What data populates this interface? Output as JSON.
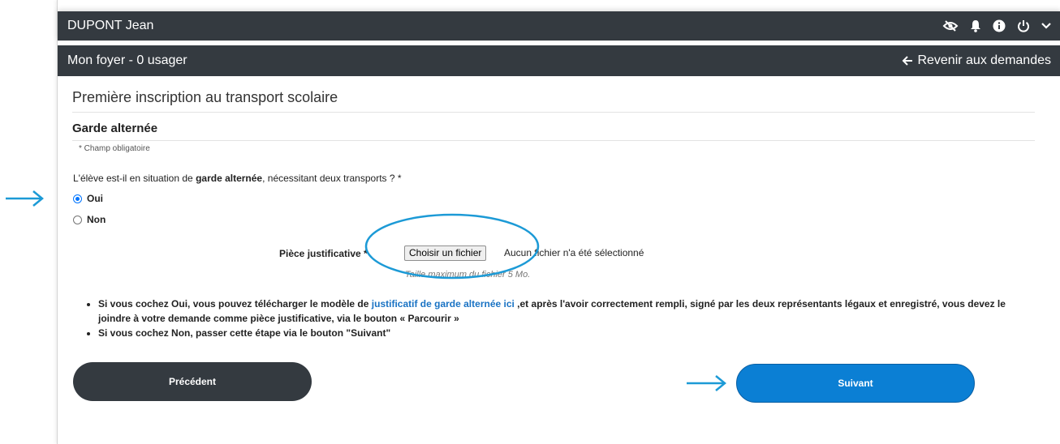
{
  "header": {
    "user_name": "DUPONT Jean",
    "icons": [
      "eye-slash-icon",
      "bell-icon",
      "info-icon",
      "power-icon",
      "chevron-down-icon"
    ]
  },
  "subheader": {
    "foyer": "Mon foyer - 0 usager",
    "back_label": "Revenir aux demandes"
  },
  "page": {
    "title": "Première inscription au transport scolaire",
    "section": "Garde alternée",
    "required_note": "* Champ obligatoire"
  },
  "question": {
    "before": "L'élève est-il en situation de ",
    "bold": "garde alternée",
    "after": ", nécessitant deux transports ? *"
  },
  "options": {
    "oui": "Oui",
    "non": "Non",
    "selected": "Oui"
  },
  "upload": {
    "label": "Pièce justificative *",
    "button": "Choisir un fichier",
    "status": "Aucun fichier n'a été sélectionné",
    "hint": "Taille maximum du fichier 5 Mo."
  },
  "info": {
    "b1_pre": "Si vous cochez Oui, vous pouvez télécharger le modèle de ",
    "b1_link": "justificatif de garde alternée ici",
    "b1_post": " ,et après l'avoir correctement rempli, signé par les deux représentants légaux et enregistré, vous devez le joindre à votre demande comme pièce justificative, via le bouton « Parcourir »",
    "b2": "Si vous cochez Non, passer cette étape via le bouton \"Suivant\""
  },
  "buttons": {
    "previous": "Précédent",
    "next": "Suivant"
  },
  "colors": {
    "bar": "#343a40",
    "primary": "#0b7fd4",
    "link": "#1a73c4",
    "annotation": "#1c9ad6"
  }
}
